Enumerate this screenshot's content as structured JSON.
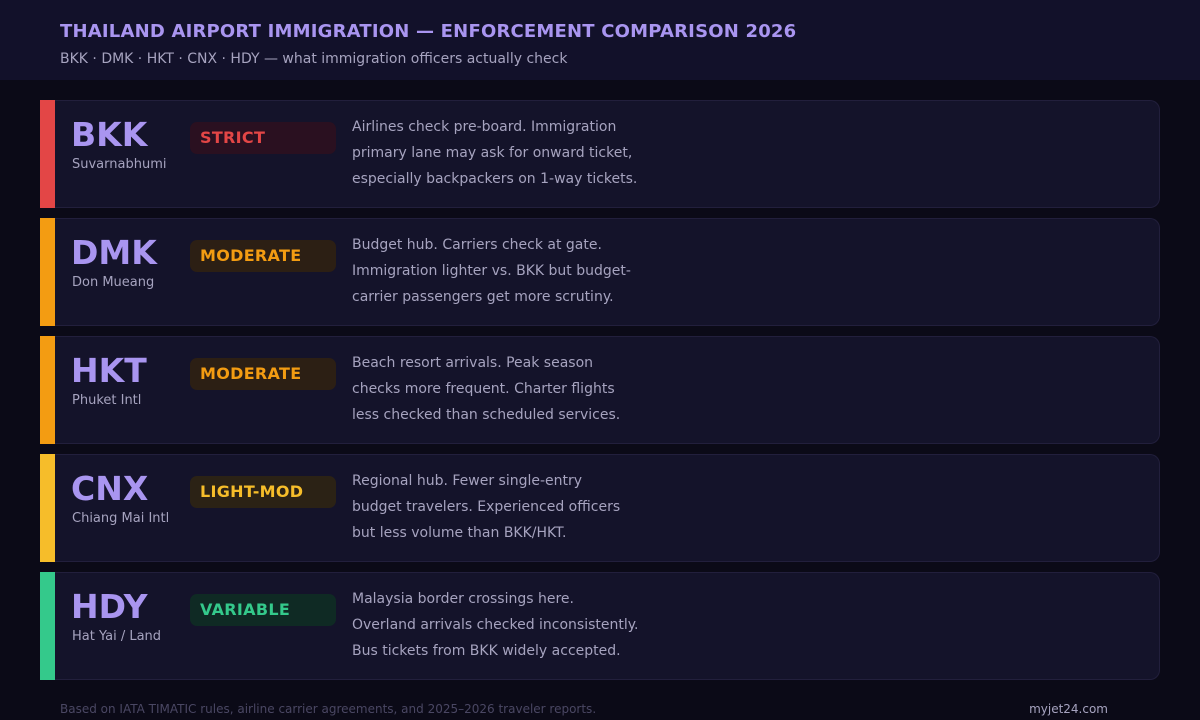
{
  "header": {
    "title": "THAILAND AIRPORT IMMIGRATION — ENFORCEMENT COMPARISON 2026",
    "subtitle": "BKK · DMK · HKT · CNX · HDY — what immigration officers actually check"
  },
  "airports": [
    {
      "code": "BKK",
      "name": "Suvarnabhumi",
      "level": "STRICT",
      "level_color": "#e34646",
      "level_bg": "#2a1020",
      "desc": [
        "Airlines check pre-board. Immigration",
        "primary lane may ask for onward ticket,",
        "especially backpackers on 1-way tickets."
      ]
    },
    {
      "code": "DMK",
      "name": "Don Mueang",
      "level": "MODERATE",
      "level_color": "#f39c12",
      "level_bg": "#2c1f14",
      "desc": [
        "Budget hub. Carriers check at gate.",
        "Immigration lighter vs. BKK but budget-",
        "carrier passengers get more scrutiny."
      ]
    },
    {
      "code": "HKT",
      "name": "Phuket Intl",
      "level": "MODERATE",
      "level_color": "#f39c12",
      "level_bg": "#2c1f14",
      "desc": [
        "Beach resort arrivals. Peak season",
        "checks more frequent. Charter flights",
        "less checked than scheduled services."
      ]
    },
    {
      "code": "CNX",
      "name": "Chiang Mai Intl",
      "level": "LIGHT-MOD",
      "level_color": "#f6bd2a",
      "level_bg": "#2b2215",
      "desc": [
        "Regional hub. Fewer single-entry",
        "budget travelers. Experienced officers",
        "but less volume than BKK/HKT."
      ]
    },
    {
      "code": "HDY",
      "name": "Hat Yai / Land",
      "level": "VARIABLE",
      "level_color": "#34c98b",
      "level_bg": "#0f2a24",
      "desc": [
        "Malaysia border crossings here.",
        "Overland arrivals checked inconsistently.",
        "Bus tickets from BKK widely accepted."
      ]
    }
  ],
  "footer": {
    "note": "Based on IATA TIMATIC rules, airline carrier agreements, and 2025–2026 traveler reports.",
    "brand": "myjet24.com"
  }
}
